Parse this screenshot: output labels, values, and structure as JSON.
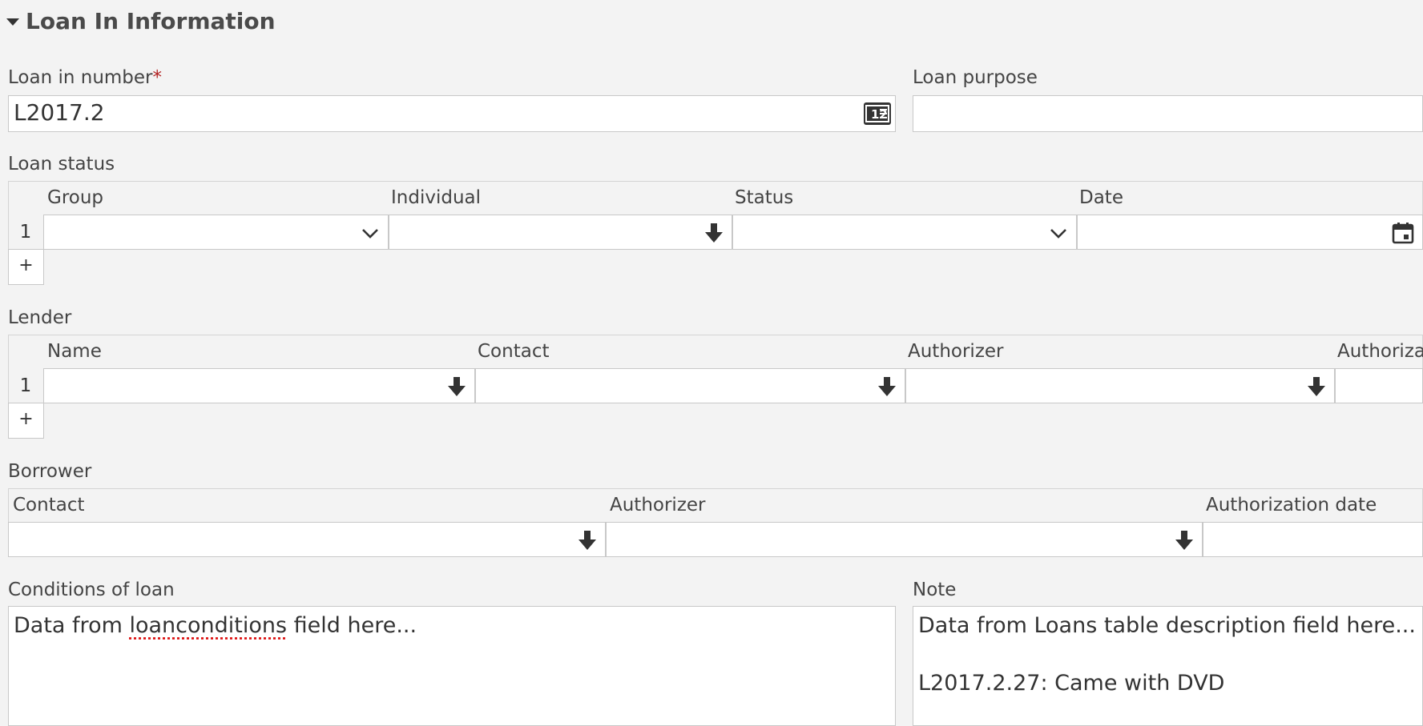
{
  "section": {
    "title": "Loan In Information"
  },
  "loan_in_number": {
    "label": "Loan in number",
    "required_mark": "*",
    "value": "L2017.2"
  },
  "loan_purpose": {
    "label": "Loan purpose",
    "value": ""
  },
  "loan_status": {
    "label": "Loan status",
    "columns": [
      "Group",
      "Individual",
      "Status",
      "Date"
    ],
    "rows": [
      {
        "num": "1"
      }
    ],
    "add_label": "+"
  },
  "lender": {
    "label": "Lender",
    "columns": [
      "Name",
      "Contact",
      "Authorizer",
      "Authoriza"
    ],
    "rows": [
      {
        "num": "1"
      }
    ],
    "add_label": "+"
  },
  "borrower": {
    "label": "Borrower",
    "columns": [
      "Contact",
      "Authorizer",
      "Authorization date"
    ]
  },
  "conditions": {
    "label": "Conditions of loan",
    "text_prefix": "Data from ",
    "text_misspelled": "loanconditions",
    "text_suffix": " field here..."
  },
  "note": {
    "label": "Note",
    "line1": "Data from Loans table description field here...",
    "line2": "L2017.2.27: Came with DVD"
  },
  "icons": {
    "caret": "caret-down-icon",
    "number_pattern": "number-pattern-icon",
    "chevron": "chevron-down-icon",
    "autocomplete": "arrow-down-icon",
    "calendar": "calendar-icon"
  }
}
